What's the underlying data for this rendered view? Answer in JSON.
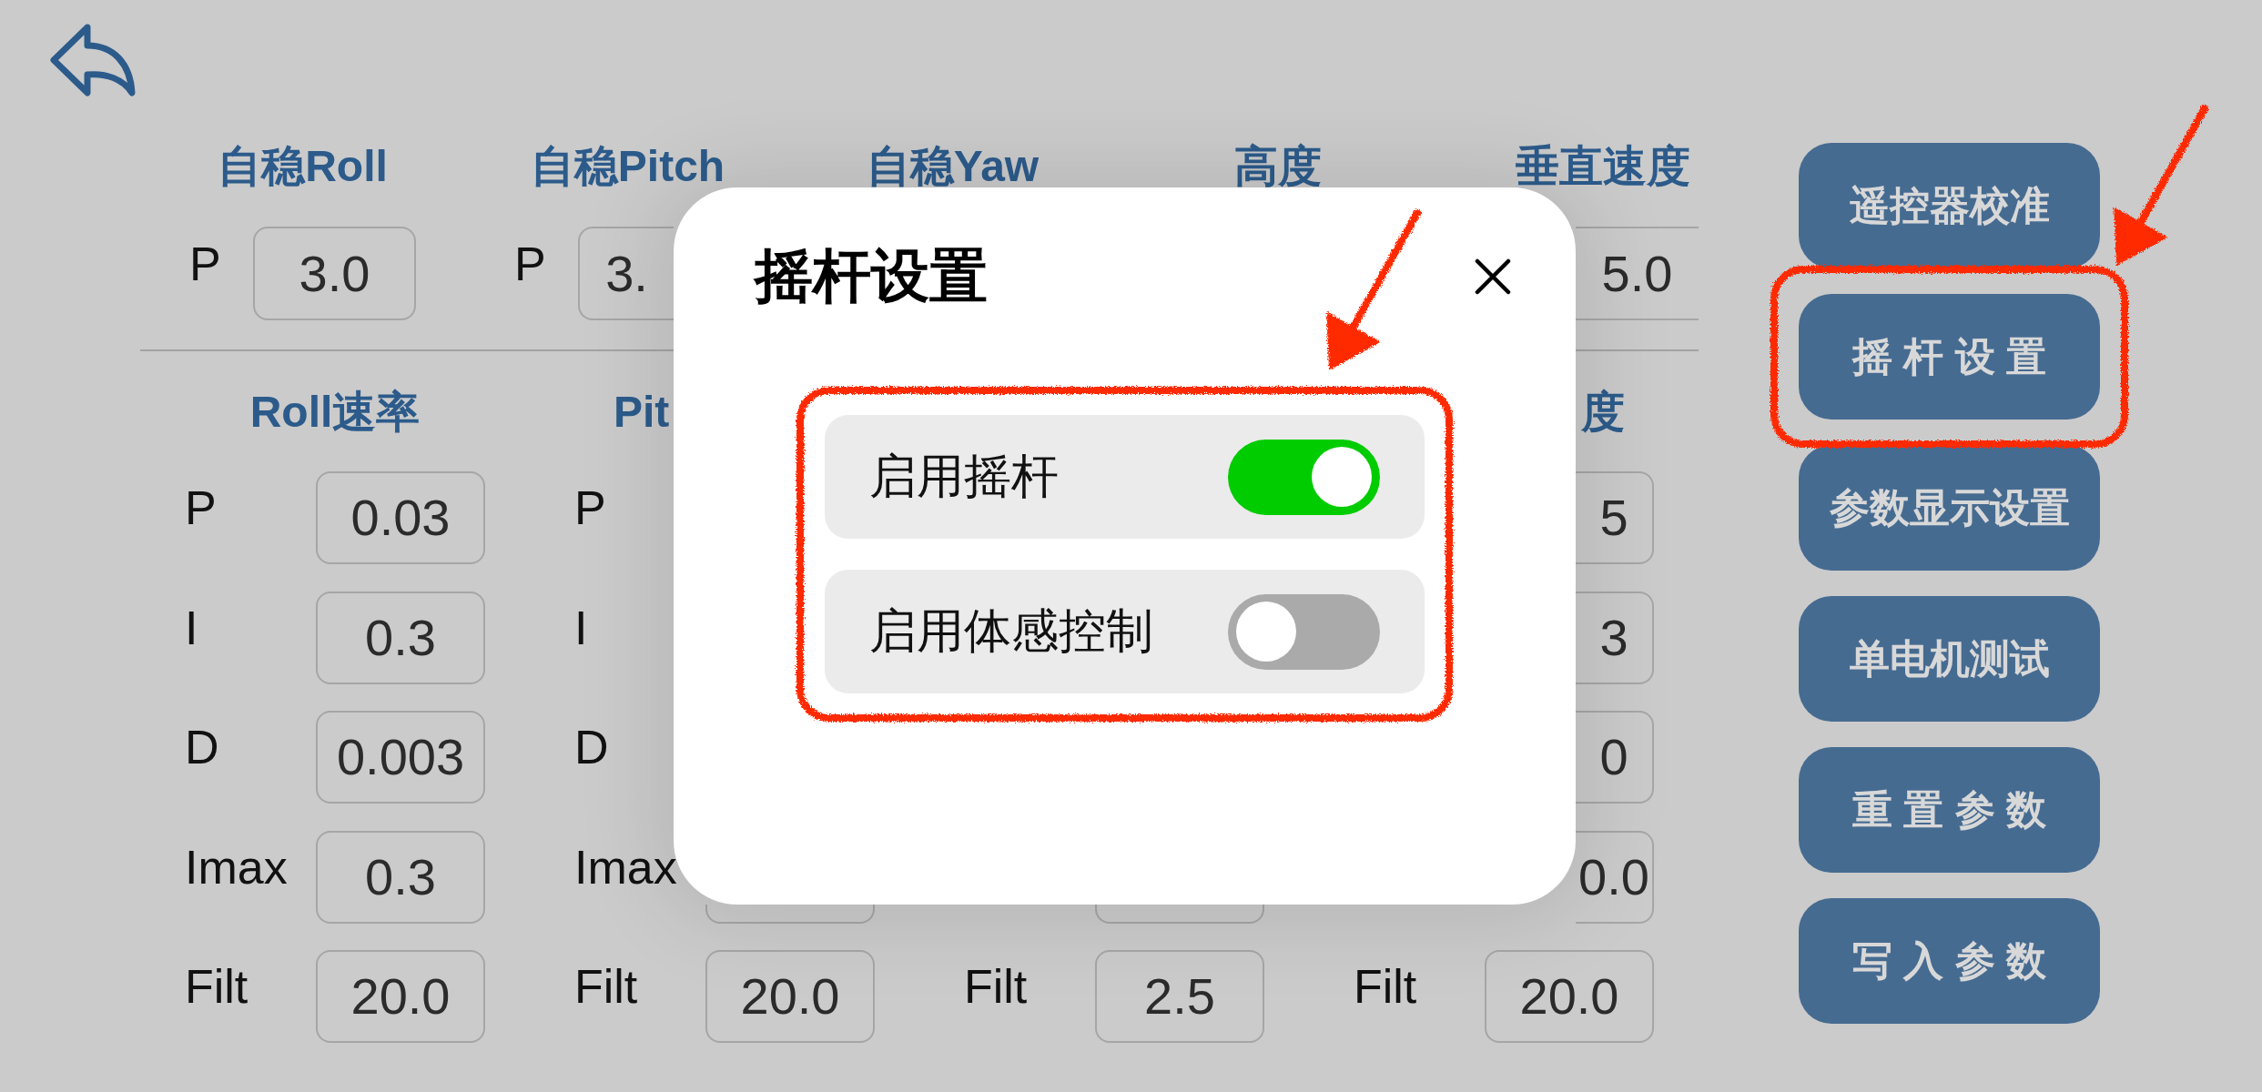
{
  "stabilize_section": {
    "columns": [
      {
        "title": "自稳Roll",
        "rows": [
          {
            "kind": "whole",
            "label": "P",
            "value": "3.0"
          }
        ]
      },
      {
        "title": "自稳Pitch",
        "rows": [
          {
            "kind": "cutright",
            "label": "P",
            "value": "3."
          }
        ]
      },
      {
        "title": "自稳Yaw"
      },
      {
        "title": "高度"
      },
      {
        "title": "垂直速度",
        "rows": [
          {
            "kind": "cutleft",
            "value": "5.0"
          }
        ]
      }
    ]
  },
  "rate_section": {
    "columns": [
      {
        "kind": "whole",
        "title": "Roll速率",
        "rows": [
          {
            "kind": "whole",
            "label": "P",
            "value": "0.03"
          },
          {
            "kind": "whole",
            "label": "I",
            "value": "0.3"
          },
          {
            "kind": "whole",
            "label": "D",
            "value": "0.003"
          },
          {
            "kind": "whole",
            "label": "Imax",
            "value": "0.3"
          },
          {
            "kind": "whole",
            "label": "Filt",
            "value": "20.0"
          }
        ]
      },
      {
        "kind": "cutright",
        "title": "Pit",
        "rows": [
          {
            "kind": "hidden",
            "label": "P"
          },
          {
            "kind": "hidden",
            "label": "I"
          },
          {
            "kind": "hidden",
            "label": "D"
          },
          {
            "kind": "cuttop",
            "label": "Imax"
          },
          {
            "kind": "whole",
            "label": "Filt",
            "value": "20.0"
          }
        ]
      },
      {
        "kind": "hidden",
        "rows": [
          {
            "kind": "hidden"
          },
          {
            "kind": "hidden"
          },
          {
            "kind": "hidden"
          },
          {
            "kind": "cuttop"
          },
          {
            "kind": "whole",
            "label": "Filt",
            "value": "2.5"
          }
        ]
      },
      {
        "kind": "cutleft",
        "title": "度",
        "rows": [
          {
            "kind": "cutleft",
            "value": "5"
          },
          {
            "kind": "cutleft",
            "value": "3"
          },
          {
            "kind": "cutleft",
            "value": "0"
          },
          {
            "kind": "cutleft",
            "value": "0.0"
          },
          {
            "kind": "whole",
            "label": "Filt",
            "value": "20.0"
          }
        ]
      }
    ]
  },
  "side_buttons": [
    {
      "label": "遥控器校准",
      "highlighted": false
    },
    {
      "label": "摇 杆 设 置",
      "highlighted": true
    },
    {
      "label": "参数显示设置",
      "highlighted": false
    },
    {
      "label": "单电机测试",
      "highlighted": false
    },
    {
      "label": "重 置 参 数",
      "highlighted": false
    },
    {
      "label": "写 入 参 数",
      "highlighted": false
    }
  ],
  "dialog": {
    "title": "摇杆设置",
    "toggles_highlighted": true,
    "toggles": [
      {
        "label": "启用摇杆",
        "on": true
      },
      {
        "label": "启用体感控制",
        "on": false
      }
    ]
  }
}
